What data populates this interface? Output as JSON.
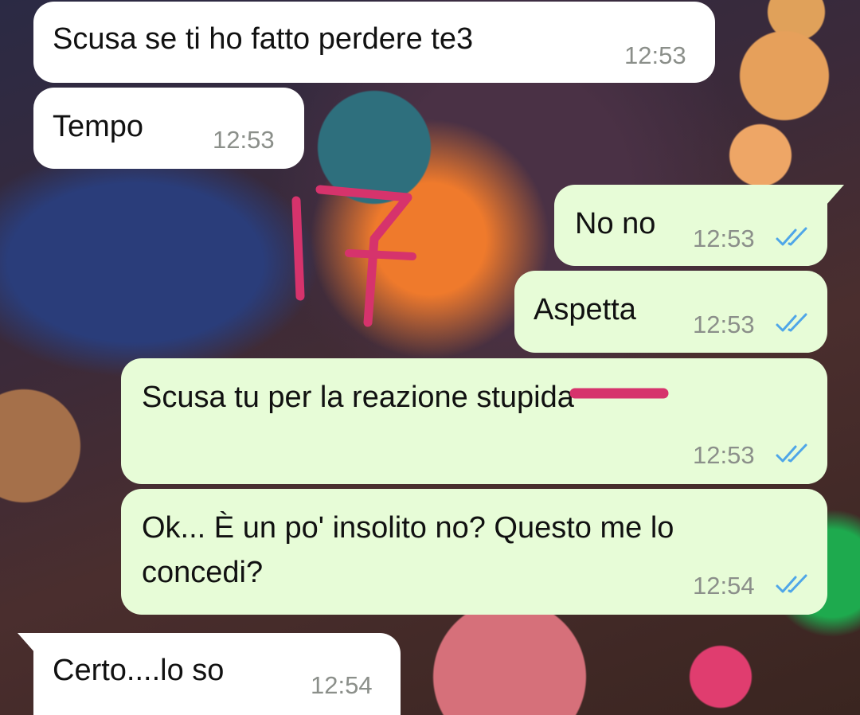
{
  "messages": [
    {
      "text": "Scusa se ti ho fatto perdere te3",
      "time": "12:53",
      "direction": "incoming"
    },
    {
      "text": "Tempo",
      "time": "12:53",
      "direction": "incoming"
    },
    {
      "text": "No no",
      "time": "12:53",
      "direction": "outgoing",
      "status": "read"
    },
    {
      "text": "Aspetta",
      "time": "12:53",
      "direction": "outgoing",
      "status": "read"
    },
    {
      "text": "Scusa tu per la reazione stupida",
      "time": "12:53",
      "direction": "outgoing",
      "status": "read"
    },
    {
      "text_line1": "Ok... È un po' insolito no? Questo me lo",
      "text_line2": "concedi?",
      "time": "12:54",
      "direction": "outgoing",
      "status": "read"
    },
    {
      "text": "Certo....lo so",
      "time": "12:54",
      "direction": "incoming"
    }
  ],
  "colors": {
    "incoming_bubble": "#ffffff",
    "outgoing_bubble": "#e7fcd7",
    "timestamp": "#8b8f8a",
    "read_ticks": "#4fa6e8",
    "handwriting": "#d6336c"
  },
  "icons": {
    "read_receipt": "double-check-icon"
  }
}
